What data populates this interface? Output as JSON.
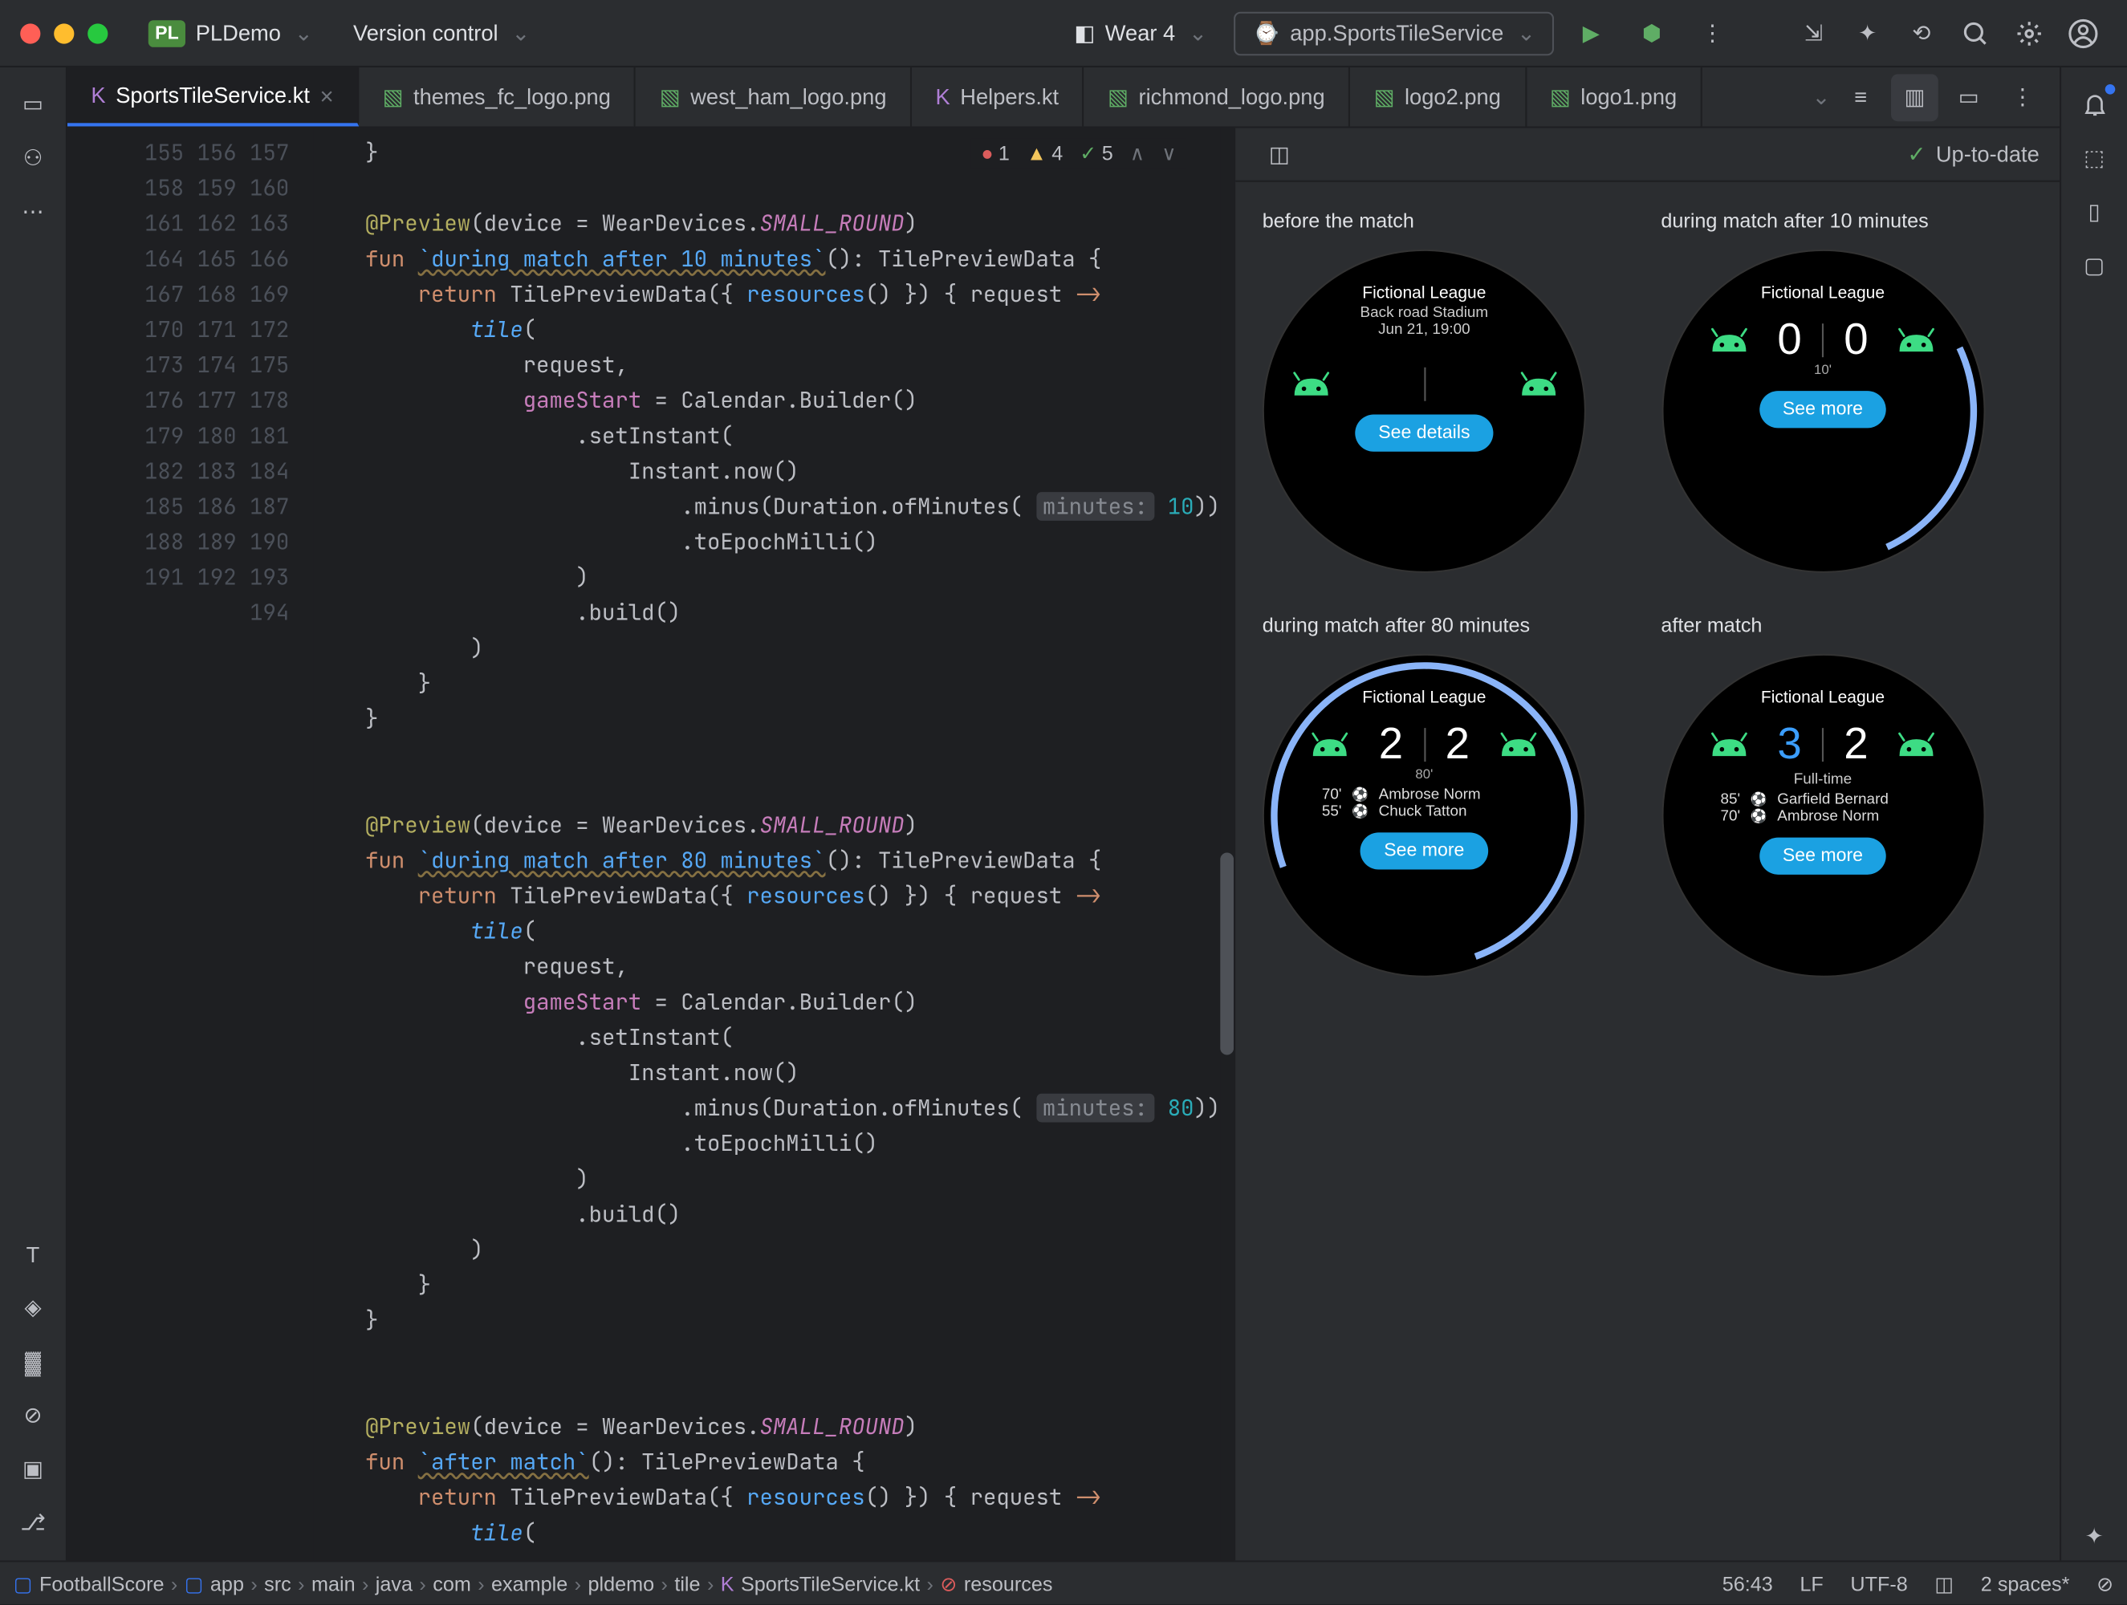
{
  "titlebar": {
    "project_badge": "PL",
    "project_name": "PLDemo",
    "vcs_label": "Version control",
    "device": "Wear 4",
    "run_config": "app.SportsTileService"
  },
  "tabs": [
    "SportsTileService.kt",
    "themes_fc_logo.png",
    "west_ham_logo.png",
    "Helpers.kt",
    "richmond_logo.png",
    "logo2.png",
    "logo1.png"
  ],
  "inspections": {
    "errors": "1",
    "warnings": "4",
    "weak": "5"
  },
  "gutter_start": 155,
  "gutter_end": 194,
  "preview": {
    "status": "Up-to-date",
    "cells": [
      {
        "title": "before the match",
        "league": "Fictional League",
        "line2": "Back road Stadium",
        "line3": "Jun 21, 19:00",
        "button": "See details"
      },
      {
        "title": "during match after 10 minutes",
        "league": "Fictional League",
        "score_home": "0",
        "score_away": "0",
        "minute": "10'",
        "button": "See more"
      },
      {
        "title": "during match after 80 minutes",
        "league": "Fictional League",
        "score_home": "2",
        "score_away": "2",
        "minute": "80'",
        "events": [
          {
            "min": "70'",
            "name": "Ambrose Norm"
          },
          {
            "min": "55'",
            "name": "Chuck Tatton"
          }
        ],
        "button": "See more"
      },
      {
        "title": "after match",
        "league": "Fictional League",
        "score_home": "3",
        "score_away": "2",
        "subtext": "Full-time",
        "home_win": true,
        "events": [
          {
            "min": "85'",
            "name": "Garfield Bernard"
          },
          {
            "min": "70'",
            "name": "Ambrose Norm"
          }
        ],
        "button": "See more"
      }
    ]
  },
  "breadcrumbs": [
    "FootballScore",
    "app",
    "src",
    "main",
    "java",
    "com",
    "example",
    "pldemo",
    "tile",
    "SportsTileService.kt",
    "resources"
  ],
  "statusbar": {
    "position": "56:43",
    "line_sep": "LF",
    "encoding": "UTF-8",
    "indent": "2 spaces*"
  }
}
